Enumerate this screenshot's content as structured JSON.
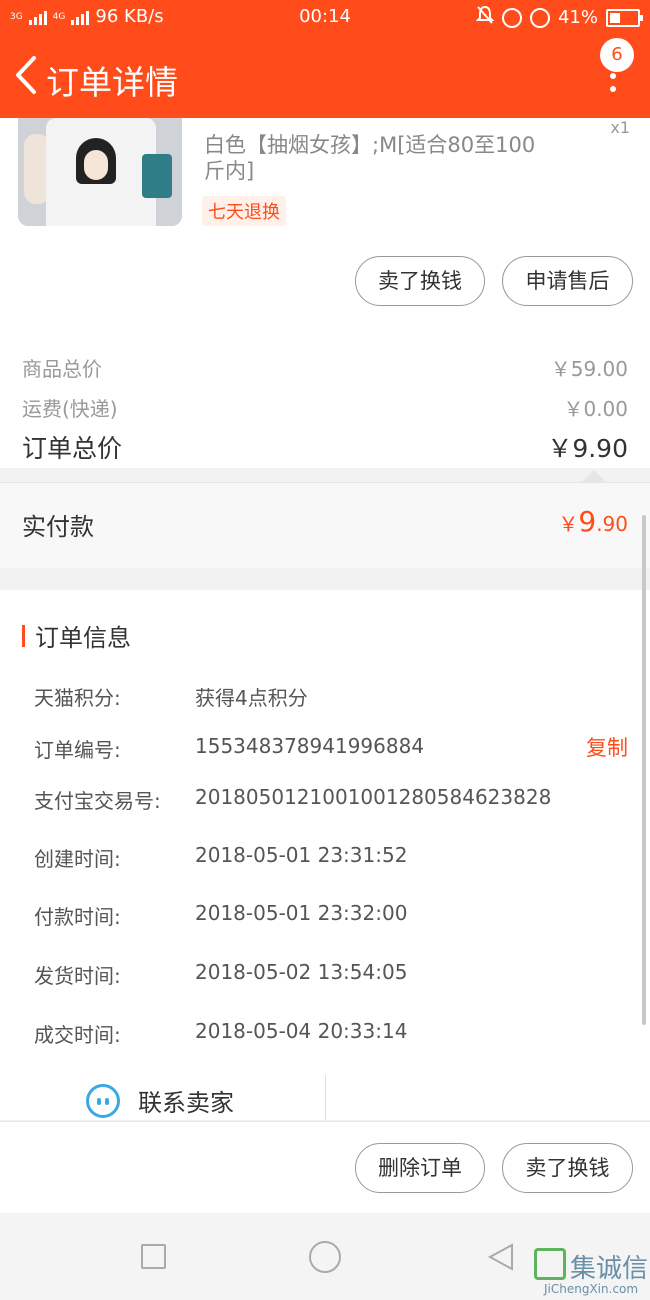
{
  "status_bar": {
    "network_left": "3G",
    "network_right": "4G",
    "speed": "96 KB/s",
    "time": "00:14",
    "battery": "41%"
  },
  "header": {
    "title": "订单详情",
    "badge_count": "6"
  },
  "product": {
    "sku_text": "白色【抽烟女孩】;M[适合80至100斤内]",
    "service_tag": "七天退换",
    "qty": "x1"
  },
  "item_actions": {
    "sell_label": "卖了换钱",
    "aftersale_label": "申请售后"
  },
  "summary": {
    "goods_total_label": "商品总价",
    "goods_total_value": "￥59.00",
    "shipping_label": "运费(快递)",
    "shipping_value": "￥0.00",
    "order_total_label": "订单总价",
    "order_total_value": "￥9.90"
  },
  "paid": {
    "label": "实付款",
    "currency": "￥",
    "integer": "9",
    "decimal": ".90"
  },
  "order_info": {
    "title": "订单信息",
    "copy_label": "复制",
    "rows": [
      {
        "key": "天猫积分:",
        "value": "获得4点积分"
      },
      {
        "key": "订单编号:",
        "value": "155348378941996884"
      },
      {
        "key": "支付宝交易号:",
        "value": "2018050121001001280584623828"
      },
      {
        "key": "创建时间:",
        "value": "2018-05-01 23:31:52"
      },
      {
        "key": "付款时间:",
        "value": "2018-05-01 23:32:00"
      },
      {
        "key": "发货时间:",
        "value": "2018-05-02 13:54:05"
      },
      {
        "key": "成交时间:",
        "value": "2018-05-04 20:33:14"
      }
    ],
    "contact_label": "联系卖家"
  },
  "bottom_actions": {
    "delete_label": "删除订单",
    "sell_label": "卖了换钱"
  },
  "watermark": {
    "text": "集诚信",
    "sub": "JiChengXin.com"
  },
  "colors": {
    "accent": "#ff4c1a",
    "contact_icon": "#3aa8e6"
  }
}
